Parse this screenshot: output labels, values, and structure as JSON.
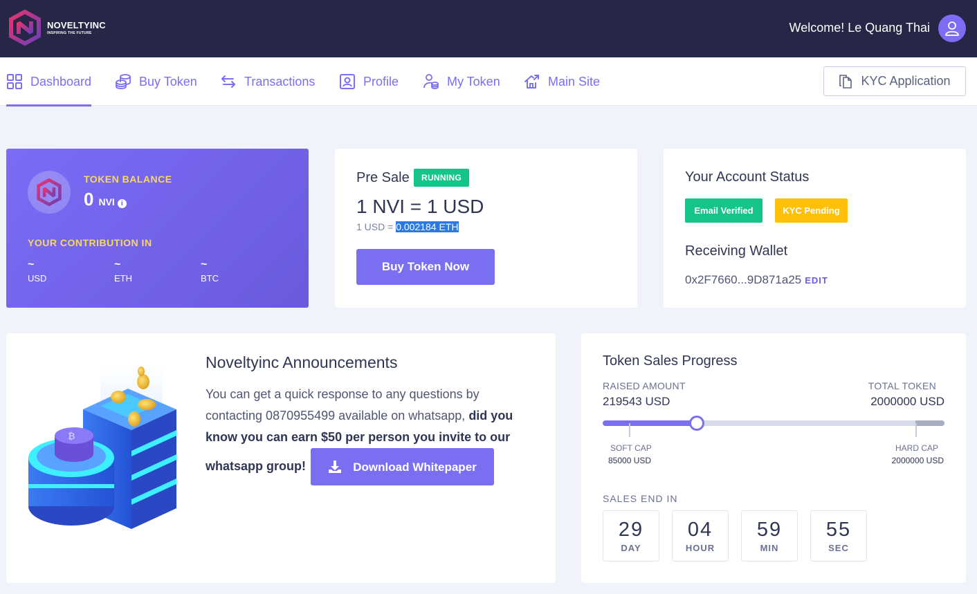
{
  "header": {
    "brand_name": "NOVELTYINC",
    "brand_tagline": "INSPIRING THE FUTURE",
    "welcome": "Welcome! Le Quang Thai"
  },
  "nav": {
    "items": [
      {
        "label": "Dashboard",
        "icon": "dashboard-grid-icon",
        "active": true
      },
      {
        "label": "Buy Token",
        "icon": "coins-icon"
      },
      {
        "label": "Transactions",
        "icon": "exchange-arrows-icon"
      },
      {
        "label": "Profile",
        "icon": "profile-card-icon"
      },
      {
        "label": "My Token",
        "icon": "user-coins-icon"
      },
      {
        "label": "Main Site",
        "icon": "home-arrow-icon"
      }
    ],
    "kyc_button": "KYC Application"
  },
  "balance": {
    "label": "TOKEN BALANCE",
    "value": "0",
    "unit": "NVI",
    "contribution_label": "YOUR CONTRIBUTION IN",
    "contributions": [
      {
        "value": "~",
        "currency": "USD"
      },
      {
        "value": "~",
        "currency": "ETH"
      },
      {
        "value": "~",
        "currency": "BTC"
      }
    ]
  },
  "presale": {
    "title": "Pre Sale",
    "status": "RUNNING",
    "rate": "1 NVI = 1 USD",
    "sub_prefix": "1 USD = ",
    "sub_value": "0.002184 ETH",
    "button": "Buy Token Now"
  },
  "account": {
    "title": "Your Account Status",
    "email_badge": "Email Verified",
    "kyc_badge": "KYC Pending",
    "wallet_title": "Receiving Wallet",
    "wallet_address": "0x2F7660...9D871a25",
    "edit": "EDIT"
  },
  "announcements": {
    "title": "Noveltyinc Announcements",
    "text_plain": "You can get a quick response to any questions by contacting 0870955499 available on whatsapp,",
    "text_bold": "did you know you can earn $50 per person you invite to our whatsapp group!",
    "download_button": "Download Whitepaper"
  },
  "progress": {
    "title": "Token Sales Progress",
    "raised_label": "RAISED AMOUNT",
    "raised_value": "219543 USD",
    "total_label": "TOTAL TOKEN",
    "total_value": "2000000 USD",
    "soft_cap_label": "SOFT CAP",
    "soft_cap_value": "85000 USD",
    "hard_cap_label": "HARD CAP",
    "hard_cap_value": "2000000 USD",
    "raised_amount": 219543,
    "soft_cap_amount": 85000,
    "total_amount": 2000000,
    "colors": {
      "accent": "#7a6ff0",
      "track": "#d7dae8"
    },
    "sales_end_label": "SALES END IN",
    "countdown": [
      {
        "value": "29",
        "unit": "DAY"
      },
      {
        "value": "04",
        "unit": "HOUR"
      },
      {
        "value": "59",
        "unit": "MIN"
      },
      {
        "value": "55",
        "unit": "SEC"
      }
    ]
  }
}
